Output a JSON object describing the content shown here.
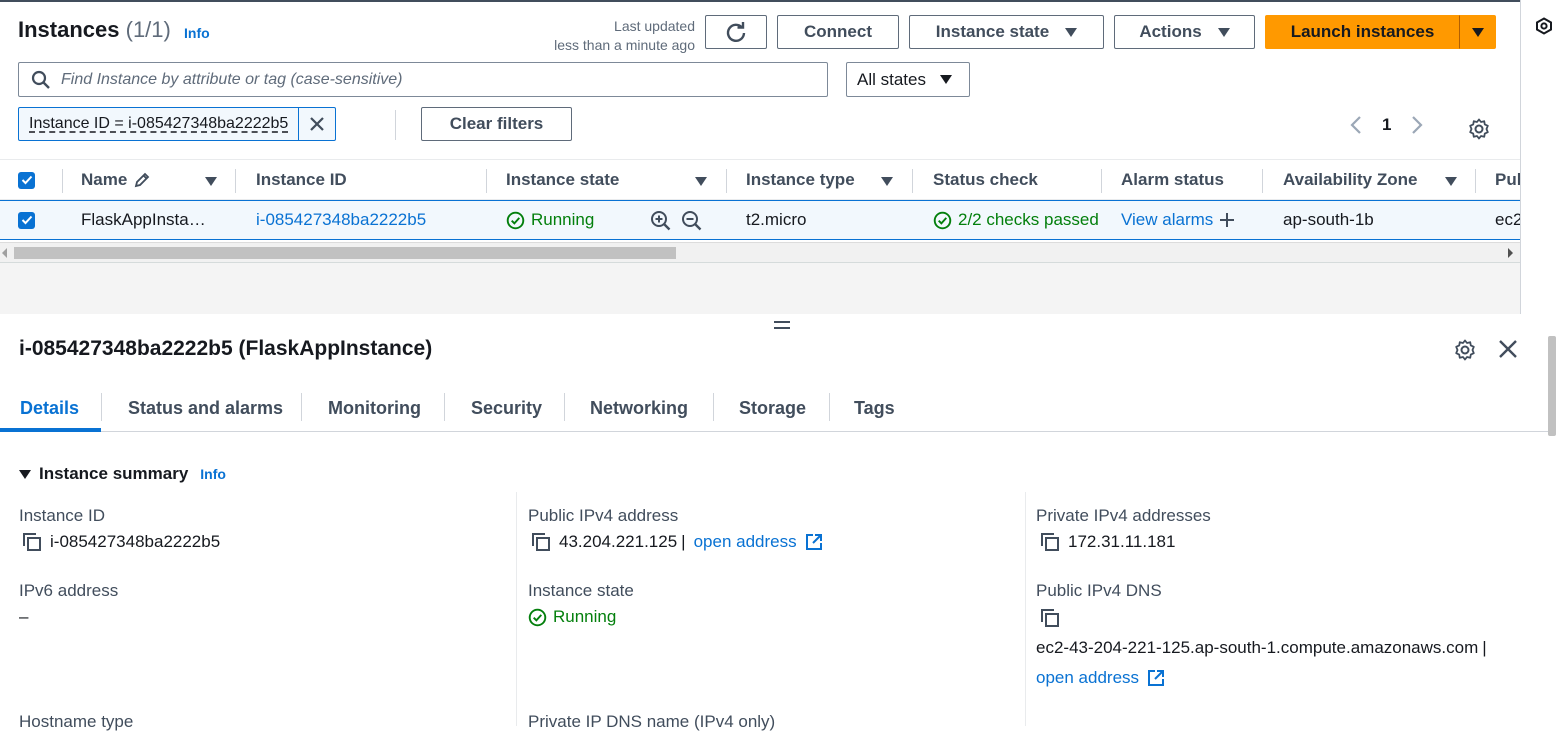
{
  "header": {
    "title": "Instances",
    "count": "(1/1)",
    "info": "Info",
    "last_updated_line1": "Last updated",
    "last_updated_line2": "less than a minute ago",
    "connect": "Connect",
    "instance_state": "Instance state",
    "actions": "Actions",
    "launch": "Launch instances"
  },
  "search": {
    "placeholder": "Find Instance by attribute or tag (case-sensitive)"
  },
  "states_filter": "All states",
  "filter_token": "Instance ID = i-085427348ba2222b5",
  "clear_filters": "Clear filters",
  "pager": {
    "page": "1"
  },
  "table": {
    "columns": [
      "Name",
      "Instance ID",
      "Instance state",
      "Instance type",
      "Status check",
      "Alarm status",
      "Availability Zone",
      "Pul"
    ],
    "row": {
      "name": "FlaskAppInsta…",
      "instance_id": "i-085427348ba2222b5",
      "state": "Running",
      "type": "t2.micro",
      "status_check": "2/2 checks passed",
      "alarm": "View alarms",
      "az": "ap-south-1b",
      "public": "ec2"
    }
  },
  "details": {
    "title": "i-085427348ba2222b5 (FlaskAppInstance)",
    "tabs": [
      "Details",
      "Status and alarms",
      "Monitoring",
      "Security",
      "Networking",
      "Storage",
      "Tags"
    ],
    "summary_title": "Instance summary",
    "summary_info": "Info",
    "fields": {
      "instance_id_label": "Instance ID",
      "instance_id_value": "i-085427348ba2222b5",
      "public_ipv4_label": "Public IPv4 address",
      "public_ipv4_value": "43.204.221.125",
      "public_ipv4_sep": "|",
      "open_address": "open address",
      "private_ipv4_label": "Private IPv4 addresses",
      "private_ipv4_value": "172.31.11.181",
      "ipv6_label": "IPv6 address",
      "ipv6_value": "–",
      "instance_state_label": "Instance state",
      "instance_state_value": "Running",
      "public_dns_label": "Public IPv4 DNS",
      "public_dns_value": "ec2-43-204-221-125.ap-south-1.compute.amazonaws.com",
      "public_dns_sep": "|",
      "open_address_2": "open address",
      "hostname_label": "Hostname type",
      "private_dns_label": "Private IP DNS name (IPv4 only)"
    }
  },
  "colors": {
    "accent": "#0972d3",
    "launch": "#ff9900",
    "success": "#037f0c"
  }
}
